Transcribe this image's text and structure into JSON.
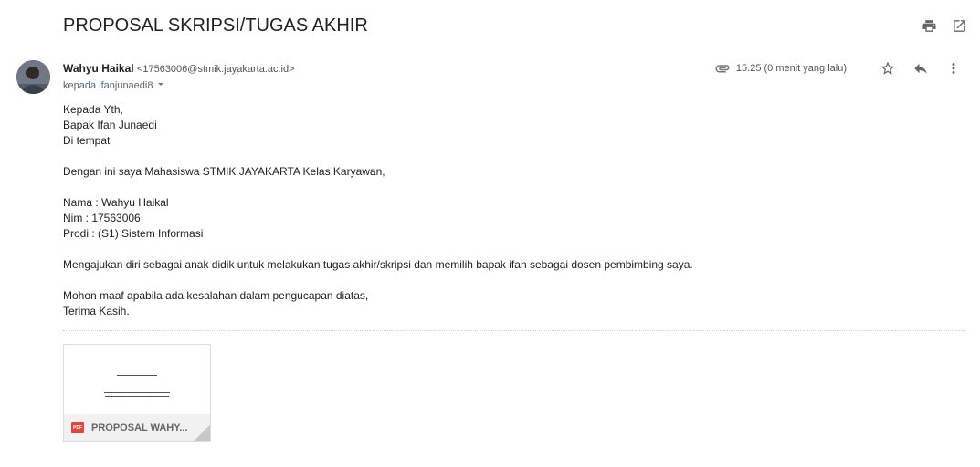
{
  "subject": "PROPOSAL SKRIPSI/TUGAS AKHIR",
  "sender": {
    "name": "Wahyu Haikal",
    "email": "<17563006@stmik.jayakarta.ac.id>",
    "to": "kepada ifanjunaedi8"
  },
  "meta": {
    "time": "15.25 (0 menit yang lalu)"
  },
  "body": {
    "l1": "Kepada Yth,",
    "l2": "Bapak Ifan Junaedi",
    "l3": "Di tempat",
    "l4": "Dengan ini saya Mahasiswa STMIK JAYAKARTA Kelas Karyawan,",
    "l5": "Nama : Wahyu Haikal",
    "l6": "Nim : 17563006",
    "l7": "Prodi : (S1) Sistem Informasi",
    "l8": "Mengajukan diri sebagai anak didik untuk melakukan tugas akhir/skripsi dan memilih bapak ifan sebagai dosen pembimbing saya.",
    "l9": "Mohon maaf apabila ada kesalahan dalam pengucapan diatas,",
    "l10": "Terima Kasih."
  },
  "attachment": {
    "name": "PROPOSAL WAHY...",
    "type_badge": "PDF"
  },
  "icons": {
    "print": "print-icon",
    "open_new": "open-in-new-icon",
    "attach": "attachment-icon",
    "star": "star-icon",
    "reply": "reply-icon",
    "more": "more-vert-icon"
  }
}
